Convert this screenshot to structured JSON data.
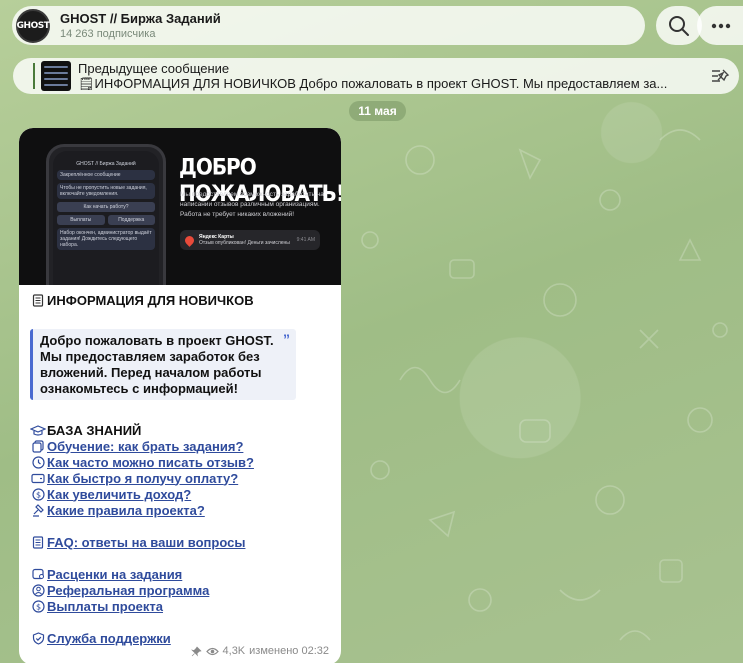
{
  "header": {
    "avatar_text": "GHOST",
    "title": "GHOST // Биржа Заданий",
    "subscribers": "14 263 подписчика"
  },
  "pinned": {
    "title": "Предыдущее сообщение",
    "preview": "🗒ИНФОРМАЦИЯ ДЛЯ НОВИЧКОВ  Добро пожаловать в проект GHOST. Мы предоставляем за..."
  },
  "date_label": "11 мая",
  "media": {
    "phone_header": "GHOST // Биржа Заданий",
    "phone_pinned": "Закреплённое сообщение",
    "phone_bubble": "Чтобы не пропустить новые задания, включайте уведомления.",
    "phone_question": "Как начать работу?",
    "phone_btn1": "Выплаты",
    "phone_btn2": "Поддержка",
    "phone_bottom": "Набор окончен, администратор выдаёт задания! Дождитесь следующего набора.",
    "headline": "ДОБРО ПОЖАЛОВАТЬ!",
    "body": "Мы предоставляем возможность заработать на написании отзывов различным организациям. Работа не требует никаких вложений!",
    "notif_title": "Яндекс Карты",
    "notif_text": "Отзыв опубликован! Деньги зачислены",
    "notif_time": "9:41 AM"
  },
  "message": {
    "title": "ИНФОРМАЦИЯ ДЛЯ НОВИЧКОВ",
    "quote": "Добро пожаловать в проект GHOST. Мы предоставляем заработок без вложений. Перед началом работы ознакомьтесь с информацией!",
    "kb_title": "БАЗА ЗНАНИЙ",
    "links_kb": [
      {
        "icon": "document-copy-icon",
        "label": "Обучение: как брать задания?"
      },
      {
        "icon": "clock-icon",
        "label": "Как часто можно писать отзыв?"
      },
      {
        "icon": "card-icon",
        "label": "Как быстро я получу оплату?"
      },
      {
        "icon": "dollar-icon",
        "label": "Как увеличить доход?"
      },
      {
        "icon": "gavel-icon",
        "label": "Какие правила проекта?"
      }
    ],
    "faq": {
      "icon": "list-icon",
      "label": "FAQ: ответы на ваши вопросы"
    },
    "links_money": [
      {
        "icon": "price-tag-icon",
        "label": "Расценки на задания"
      },
      {
        "icon": "referral-icon",
        "label": "Реферальная программа"
      },
      {
        "icon": "dollar-icon",
        "label": "Выплаты проекта"
      }
    ],
    "support": {
      "icon": "shield-check-icon",
      "label": "Служба поддержки"
    },
    "views": "4,3K",
    "edited": "изменено 02:32"
  },
  "colors": {
    "link": "#2f4b9c",
    "quote_border": "#4a6ad0",
    "background": "#a9c58f"
  }
}
